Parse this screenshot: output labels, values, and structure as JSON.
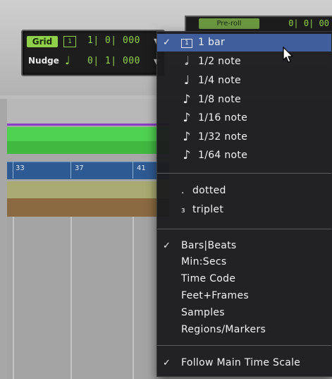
{
  "counter": {
    "grid_label": "Grid",
    "grid_icon": "bar-grid-icon",
    "grid_value": "1| 0| 000",
    "nudge_label": "Nudge",
    "nudge_icon": "quarter-note-icon",
    "nudge_value": "0| 1| 000"
  },
  "mini_display": {
    "button_label": "Pre-roll",
    "value": "0| 0| 00"
  },
  "ruler": {
    "bars": [
      "33",
      "37",
      "41"
    ]
  },
  "menu": {
    "note_values": [
      {
        "label": "1 bar",
        "checked": true,
        "selected": true,
        "icon": "bar-icon"
      },
      {
        "label": "1/2 note",
        "icon": "half-note-icon"
      },
      {
        "label": "1/4 note",
        "icon": "quarter-note-icon"
      },
      {
        "label": "1/8 note",
        "icon": "eighth-note-icon"
      },
      {
        "label": "1/16 note",
        "icon": "sixteenth-note-icon"
      },
      {
        "label": "1/32 note",
        "icon": "thirty-second-note-icon"
      },
      {
        "label": "1/64 note",
        "icon": "sixty-fourth-note-icon"
      }
    ],
    "modifiers": [
      {
        "label": "dotted",
        "symbol": "."
      },
      {
        "label": "triplet",
        "symbol": "₃"
      }
    ],
    "time_scales": [
      {
        "label": "Bars|Beats",
        "checked": true
      },
      {
        "label": "Min:Secs"
      },
      {
        "label": "Time Code"
      },
      {
        "label": "Feet+Frames"
      },
      {
        "label": "Samples"
      },
      {
        "label": "Regions/Markers"
      }
    ],
    "follow": {
      "label": "Follow Main Time Scale",
      "checked": true
    },
    "check_glyph": "✓"
  }
}
